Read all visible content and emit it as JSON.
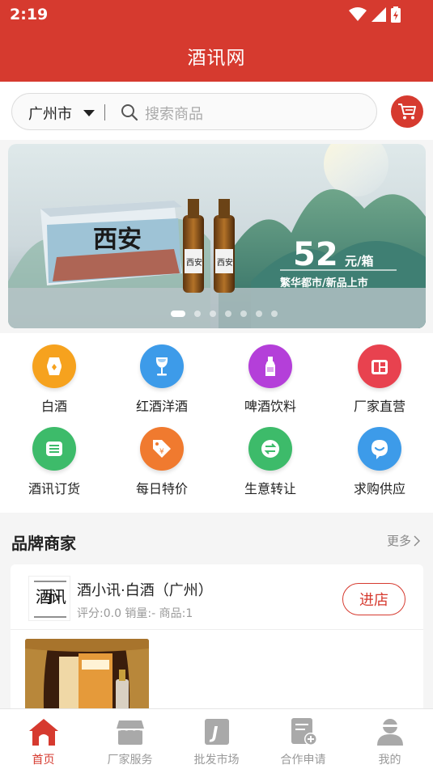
{
  "status_bar": {
    "time": "2:19"
  },
  "header": {
    "title": "酒讯网"
  },
  "search": {
    "city": "广州市",
    "placeholder": "搜索商品"
  },
  "banner": {
    "box_text": "西安",
    "bottle_text": "西安",
    "price": "52",
    "price_unit": "元/箱",
    "slogan": "繁华都市/新品上市",
    "dot_count": 7,
    "active_dot": 0
  },
  "categories": [
    {
      "label": "白酒",
      "icon": "baijiu-icon",
      "color": "#f6a21e"
    },
    {
      "label": "红酒洋酒",
      "icon": "wine-glass-icon",
      "color": "#3d9be9"
    },
    {
      "label": "啤酒饮料",
      "icon": "beer-bottle-icon",
      "color": "#b43fd9"
    },
    {
      "label": "厂家直营",
      "icon": "factory-store-icon",
      "color": "#e8424f"
    },
    {
      "label": "酒讯订货",
      "icon": "order-list-icon",
      "color": "#3dbb6a"
    },
    {
      "label": "每日特价",
      "icon": "price-tag-icon",
      "color": "#f07a2f"
    },
    {
      "label": "生意转让",
      "icon": "transfer-icon",
      "color": "#3dbb6a"
    },
    {
      "label": "求购供应",
      "icon": "chat-smile-icon",
      "color": "#3d9be9"
    }
  ],
  "brands": {
    "title": "品牌商家",
    "more": "更多",
    "store": {
      "logo_text": "酒小讯",
      "name": "酒小讯·白酒（广州）",
      "meta": "评分:0.0 销量:- 商品:1",
      "enter": "进店"
    }
  },
  "tabbar": [
    {
      "label": "首页",
      "icon": "home-icon",
      "active": true
    },
    {
      "label": "厂家服务",
      "icon": "storefront-icon",
      "active": false
    },
    {
      "label": "批发市场",
      "icon": "wholesale-j-icon",
      "active": false
    },
    {
      "label": "合作申请",
      "icon": "apply-document-icon",
      "active": false
    },
    {
      "label": "我的",
      "icon": "user-icon",
      "active": false
    }
  ],
  "colors": {
    "brand": "#d63a2f",
    "inactive_tab": "#999999"
  }
}
